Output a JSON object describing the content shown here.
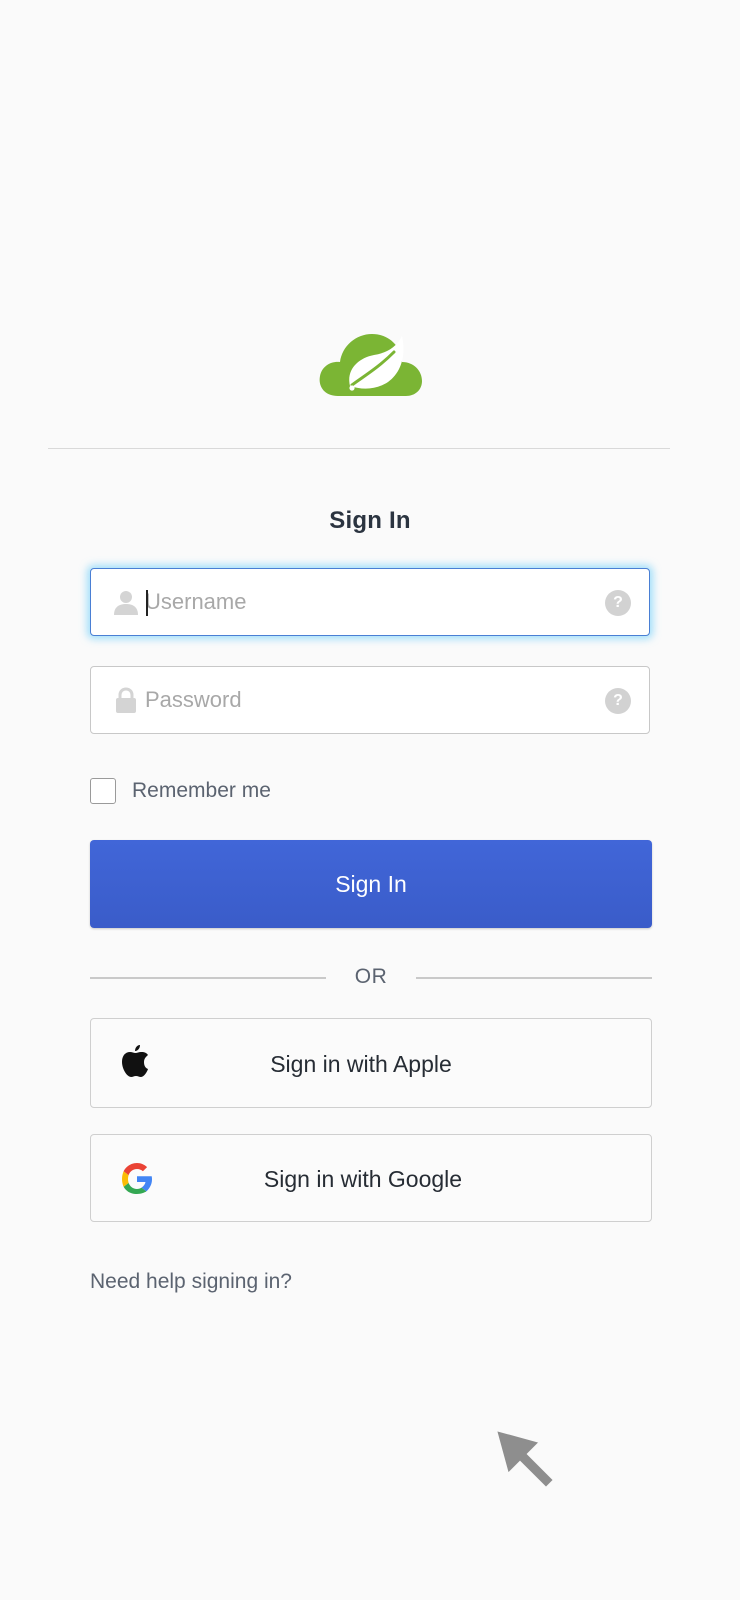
{
  "form": {
    "title": "Sign In",
    "username": {
      "placeholder": "Username",
      "value": "",
      "help_icon": "question-mark-icon",
      "icon": "user-icon"
    },
    "password": {
      "placeholder": "Password",
      "value": "",
      "help_icon": "question-mark-icon",
      "icon": "lock-icon"
    },
    "remember_me": {
      "label": "Remember me",
      "checked": false
    },
    "submit_label": "Sign In",
    "separator": "OR",
    "social": [
      {
        "label": "Sign in with Apple",
        "icon": "apple-icon"
      },
      {
        "label": "Sign in with Google",
        "icon": "google-icon"
      }
    ],
    "help_link": "Need help signing in?"
  },
  "brand": {
    "logo": "spring-leaf-cloud-logo",
    "logo_color": "#7bb534"
  },
  "colors": {
    "primary_button": "#3f63d3",
    "focus_glow": "#5ac8fa"
  }
}
